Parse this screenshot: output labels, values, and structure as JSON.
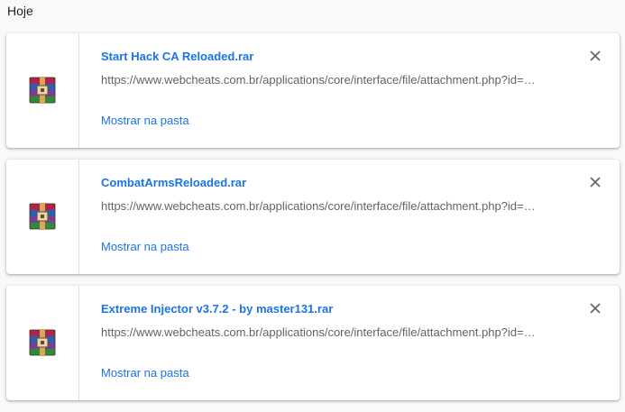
{
  "section": {
    "date_label": "Hoje"
  },
  "downloads": [
    {
      "file_name": "Start Hack CA Reloaded.rar",
      "url": "https://www.webcheats.com.br/applications/core/interface/file/attachment.php?id=…",
      "action_label": "Mostrar na pasta",
      "icon": "winrar-archive-icon",
      "close_icon": "close-icon"
    },
    {
      "file_name": "CombatArmsReloaded.rar",
      "url": "https://www.webcheats.com.br/applications/core/interface/file/attachment.php?id=…",
      "action_label": "Mostrar na pasta",
      "icon": "winrar-archive-icon",
      "close_icon": "close-icon"
    },
    {
      "file_name": "Extreme Injector v3.7.2 - by master131.rar",
      "url": "https://www.webcheats.com.br/applications/core/interface/file/attachment.php?id=…",
      "action_label": "Mostrar na pasta",
      "icon": "winrar-archive-icon",
      "close_icon": "close-icon"
    }
  ],
  "colors": {
    "link": "#1a73e8",
    "secondary_text": "#5f6368",
    "background": "#f8f9fa",
    "card": "#ffffff"
  }
}
